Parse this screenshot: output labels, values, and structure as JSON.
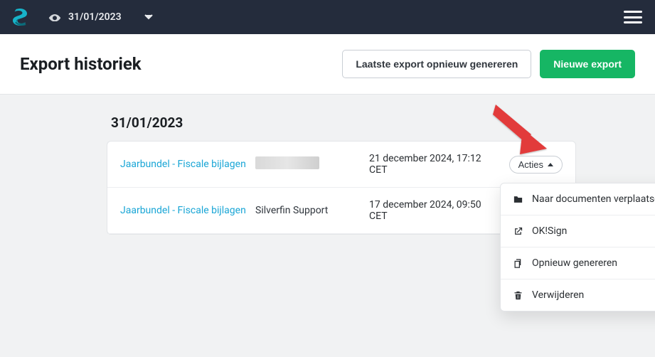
{
  "nav": {
    "date": "31/01/2023"
  },
  "header": {
    "title": "Export historiek",
    "regenerate_last": "Laatste export opnieuw genereren",
    "new_export": "Nieuwe export"
  },
  "group": {
    "title": "31/01/2023"
  },
  "rows": [
    {
      "title": "Jaarbundel - Fiscale bijlagen",
      "user": "",
      "date": "21 december 2024, 17:12 CET",
      "actions_label": "Acties"
    },
    {
      "title": "Jaarbundel - Fiscale bijlagen",
      "user": "Silverfin Support",
      "date": "17 december 2024, 09:50 CET"
    }
  ],
  "menu": {
    "move": "Naar documenten verplaatsen",
    "oksign": "OK!Sign",
    "regen": "Opnieuw genereren",
    "delete": "Verwijderen"
  }
}
